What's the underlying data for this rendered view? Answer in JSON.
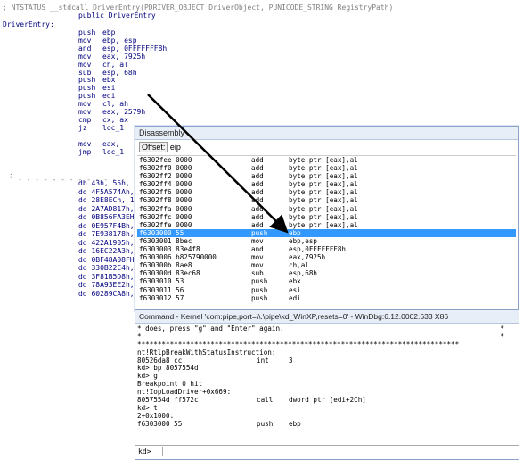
{
  "ida": {
    "header": "; NTSTATUS __stdcall DriverEntry(PDRIVER_OBJECT DriverObject, PUNICODE_STRING RegistryPath)",
    "public_decl": "public DriverEntry",
    "label": "DriverEntry:",
    "code": [
      {
        "op": "push",
        "arg": "ebp"
      },
      {
        "op": "mov",
        "arg": "ebp, esp"
      },
      {
        "op": "and",
        "arg": "esp, 0FFFFFFF8h"
      },
      {
        "op": "mov",
        "arg": "eax, 7925h"
      },
      {
        "op": "mov",
        "arg": "ch, al"
      },
      {
        "op": "sub",
        "arg": "esp, 68h"
      },
      {
        "op": "push",
        "arg": "ebx"
      },
      {
        "op": "push",
        "arg": "esi"
      },
      {
        "op": "push",
        "arg": "edi"
      },
      {
        "op": "mov",
        "arg": "cl, ah"
      },
      {
        "op": "mov",
        "arg": "eax, 2579h"
      },
      {
        "op": "cmp",
        "arg": "cx, ax"
      },
      {
        "op": "jz",
        "arg": "loc_1"
      },
      {
        "op": "",
        "arg": ""
      },
      {
        "op": "mov",
        "arg": "eax,"
      },
      {
        "op": "jmp",
        "arg": "loc_1"
      }
    ],
    "separator": ";",
    "data": [
      "db 43h, 55h,",
      "dd 4F5A574Ah,",
      "dd 28E8ECh, 1",
      "dd 2A7AD817h,",
      "dd 0B856FA3EH",
      "dd 0E957F4Bh,",
      "dd 7E938178h,",
      "dd 422A1905h,",
      "dd 16EC22A3h,",
      "dd 0BF48A08FH",
      "dd 330B22C4h,",
      "dd 3F81B5D8h,",
      "dd 78A93EE2h,",
      "dd 60289CA8h,"
    ]
  },
  "disassembly": {
    "title": "Disassembly",
    "offset_label": "Offset:",
    "offset_value": "eip",
    "rows": [
      {
        "addr": "f6302fee 0000",
        "op": "add",
        "args": "byte ptr [eax],al"
      },
      {
        "addr": "f6302ff0 0000",
        "op": "add",
        "args": "byte ptr [eax],al"
      },
      {
        "addr": "f6302ff2 0000",
        "op": "add",
        "args": "byte ptr [eax],al"
      },
      {
        "addr": "f6302ff4 0000",
        "op": "add",
        "args": "byte ptr [eax],al"
      },
      {
        "addr": "f6302ff6 0000",
        "op": "add",
        "args": "byte ptr [eax],al"
      },
      {
        "addr": "f6302ff8 0000",
        "op": "add",
        "args": "byte ptr [eax],al"
      },
      {
        "addr": "f6302ffa 0000",
        "op": "add",
        "args": "byte ptr [eax],al"
      },
      {
        "addr": "f6302ffc 0000",
        "op": "add",
        "args": "byte ptr [eax],al"
      },
      {
        "addr": "f6302ffe 0000",
        "op": "add",
        "args": "byte ptr [eax],al"
      },
      {
        "addr": "f6303000 55",
        "op": "push",
        "args": "ebp"
      },
      {
        "addr": "f6303001 8bec",
        "op": "mov",
        "args": "ebp,esp"
      },
      {
        "addr": "f6303003 83e4f8",
        "op": "and",
        "args": "esp,0FFFFFFF8h"
      },
      {
        "addr": "f6303006 b825790000",
        "op": "mov",
        "args": "eax,7925h"
      },
      {
        "addr": "f630300b 8ae8",
        "op": "mov",
        "args": "ch,al"
      },
      {
        "addr": "f630300d 83ec68",
        "op": "sub",
        "args": "esp,68h"
      },
      {
        "addr": "f6303010 53",
        "op": "push",
        "args": "ebx"
      },
      {
        "addr": "f6303011 56",
        "op": "push",
        "args": "esi"
      },
      {
        "addr": "f6303012 57",
        "op": "push",
        "args": "edi"
      }
    ],
    "selected_index": 9
  },
  "command": {
    "title": "Command - Kernel 'com:pipe,port=\\\\.\\pipe\\kd_WinXP,resets=0' - WinDbg:6.12.0002.633 X86",
    "lines": [
      {
        "a": "* does, press \"g\" and \"Enter\" again.",
        "b": "",
        "c": "",
        "star": "*"
      },
      {
        "a": "*",
        "b": "",
        "c": "",
        "star": "*"
      },
      {
        "a": "*******************************************************************************",
        "b": "",
        "c": "",
        "star": ""
      },
      {
        "a": "nt!RtlpBreakWithStatusInstruction:",
        "b": "",
        "c": "",
        "star": ""
      },
      {
        "a": "80526da8 cc",
        "b": "int",
        "c": "3",
        "star": ""
      },
      {
        "a": "kd> bp 8057554d",
        "b": "",
        "c": "",
        "star": ""
      },
      {
        "a": "kd> g",
        "b": "",
        "c": "",
        "star": ""
      },
      {
        "a": "Breakpoint 0 hit",
        "b": "",
        "c": "",
        "star": ""
      },
      {
        "a": "nt!IopLoadDriver+0x669:",
        "b": "",
        "c": "",
        "star": ""
      },
      {
        "a": "8057554d ff572c",
        "b": "call",
        "c": "dword ptr [edi+2Ch]",
        "star": ""
      },
      {
        "a": "kd> t",
        "b": "",
        "c": "",
        "star": ""
      },
      {
        "a": "2+0x1000:",
        "b": "",
        "c": "",
        "star": ""
      },
      {
        "a": "f6303000 55",
        "b": "push",
        "c": "ebp",
        "star": ""
      }
    ],
    "prompt": "kd>"
  }
}
